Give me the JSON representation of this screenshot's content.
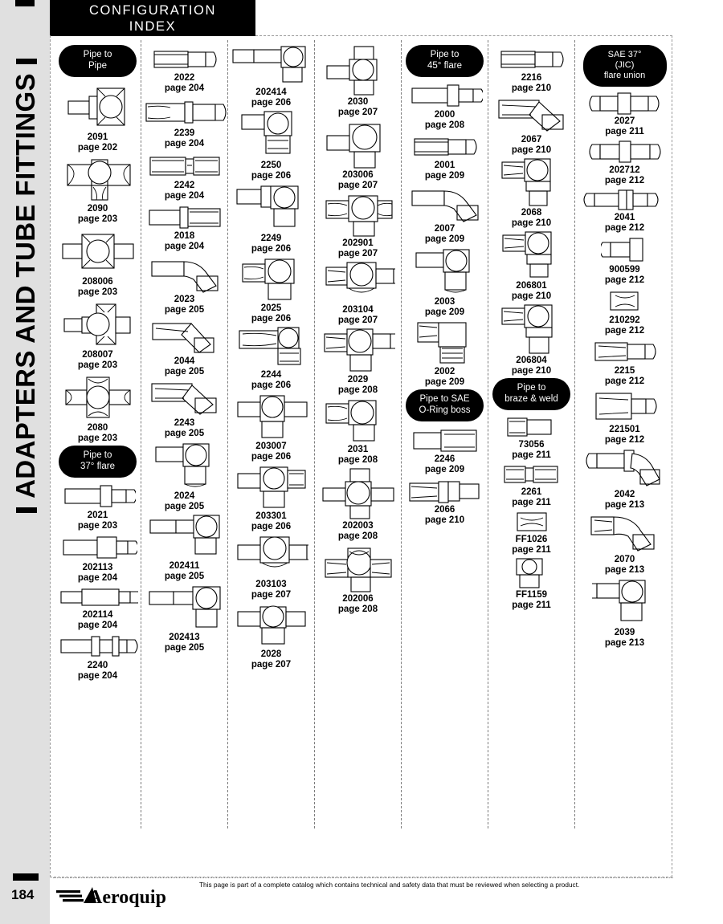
{
  "spine": {
    "title": "ADAPTERS AND TUBE FITTINGS"
  },
  "header": {
    "line1": "CONFIGURATION",
    "line2": "INDEX"
  },
  "footer": {
    "page_number": "184",
    "logo_text": "Aeroquip",
    "disclaimer": "This page is part of a complete catalog which contains technical and safety data that must be reviewed when selecting a product."
  },
  "columns": [
    {
      "name": "column-1",
      "blocks": [
        {
          "heading": "Pipe to\nPipe",
          "heading_lines": [
            "Pipe to",
            "Pipe"
          ],
          "items": [
            {
              "part": "2091",
              "page": "page 202",
              "art": "tee-male-run"
            },
            {
              "part": "2090",
              "page": "page 203",
              "art": "tee-plain"
            },
            {
              "part": "208006",
              "page": "page 203",
              "art": "cross-male-2"
            },
            {
              "part": "208007",
              "page": "page 203",
              "art": "cross-male-1"
            },
            {
              "part": "2080",
              "page": "page 203",
              "art": "cross-plain"
            }
          ]
        },
        {
          "heading_lines": [
            "Pipe to",
            "37° flare"
          ],
          "items": [
            {
              "part": "2021",
              "page": "page 203",
              "art": "straight-hex-mid"
            },
            {
              "part": "202113",
              "page": "page 204",
              "art": "straight-long-hex"
            },
            {
              "part": "202114",
              "page": "page 204",
              "art": "straight-long-plain"
            },
            {
              "part": "2240",
              "page": "page 204",
              "art": "straight-double-hex"
            }
          ]
        }
      ]
    },
    {
      "name": "column-2",
      "blocks": [
        {
          "heading_lines": [],
          "items": [
            {
              "part": "2022",
              "page": "page 204",
              "art": "straight-female-male"
            },
            {
              "part": "2239",
              "page": "page 204",
              "art": "straight-nut-long"
            },
            {
              "part": "2242",
              "page": "page 204",
              "art": "straight-swivel"
            },
            {
              "part": "2018",
              "page": "page 204",
              "art": "straight-male-swivel"
            },
            {
              "part": "2023",
              "page": "page 205",
              "art": "elbow45-male"
            },
            {
              "part": "2044",
              "page": "page 205",
              "art": "elbow45-female"
            },
            {
              "part": "2243",
              "page": "page 205",
              "art": "elbow45-swivel"
            },
            {
              "part": "2024",
              "page": "page 205",
              "art": "elbow90-male"
            },
            {
              "part": "202411",
              "page": "page 205",
              "art": "elbow90-long"
            },
            {
              "part": "202413",
              "page": "page 205",
              "art": "elbow90-long2"
            }
          ]
        }
      ]
    },
    {
      "name": "column-3",
      "blocks": [
        {
          "heading_lines": [],
          "items": [
            {
              "part": "202414",
              "page": "page 206",
              "art": "elbow90-extlong"
            },
            {
              "part": "2250",
              "page": "page 206",
              "art": "elbow90-swivel"
            },
            {
              "part": "2249",
              "page": "page 206",
              "art": "elbow90-male-hex"
            },
            {
              "part": "2025",
              "page": "page 206",
              "art": "elbow90-female-down"
            },
            {
              "part": "2244",
              "page": "page 206",
              "art": "elbow90-plain-down"
            },
            {
              "part": "203007",
              "page": "page 206",
              "art": "tee-3male"
            },
            {
              "part": "203301",
              "page": "page 206",
              "art": "tee-male-branch"
            },
            {
              "part": "203103",
              "page": "page 207",
              "art": "tee-run-male"
            },
            {
              "part": "2028",
              "page": "page 207",
              "art": "tee-male-all"
            }
          ]
        }
      ]
    },
    {
      "name": "column-4",
      "blocks": [
        {
          "heading_lines": [],
          "items": [
            {
              "part": "2030",
              "page": "page 207",
              "art": "tee-vertical-male"
            },
            {
              "part": "203006",
              "page": "page 207",
              "art": "tee-down-male"
            },
            {
              "part": "202901",
              "page": "page 207",
              "art": "tee-branch-down"
            },
            {
              "part": "203104",
              "page": "page 207",
              "art": "tee-right-male"
            },
            {
              "part": "2029",
              "page": "page 208",
              "art": "tee-two-male"
            },
            {
              "part": "2031",
              "page": "page 208",
              "art": "tee-up-male"
            },
            {
              "part": "202003",
              "page": "page 208",
              "art": "cross-4male"
            },
            {
              "part": "202006",
              "page": "page 208",
              "art": "cross-down-male"
            }
          ]
        }
      ]
    },
    {
      "name": "column-5",
      "blocks": [
        {
          "heading_lines": [
            "Pipe to",
            "45° flare"
          ],
          "items": [
            {
              "part": "2000",
              "page": "page 208",
              "art": "straight-hex-mid"
            },
            {
              "part": "2001",
              "page": "page 209",
              "art": "straight-female-male"
            },
            {
              "part": "2007",
              "page": "page 209",
              "art": "elbow45-male"
            },
            {
              "part": "2003",
              "page": "page 209",
              "art": "elbow90-male"
            },
            {
              "part": "2002",
              "page": "page 209",
              "art": "elbow90-female"
            }
          ]
        },
        {
          "heading_lines": [
            "Pipe to SAE",
            "O-Ring boss"
          ],
          "items": [
            {
              "part": "2246",
              "page": "page 209",
              "art": "straight-male-female"
            },
            {
              "part": "2066",
              "page": "page 210",
              "art": "straight-swivel-male"
            }
          ]
        }
      ]
    },
    {
      "name": "column-6",
      "blocks": [
        {
          "heading_lines": [],
          "items": [
            {
              "part": "2216",
              "page": "page 210",
              "art": "straight-female-male"
            },
            {
              "part": "2067",
              "page": "page 210",
              "art": "elbow45-swivel"
            },
            {
              "part": "2068",
              "page": "page 210",
              "art": "elbow90-swivel-down"
            },
            {
              "part": "206801",
              "page": "page 210",
              "art": "elbow90-plain-boss"
            },
            {
              "part": "206804",
              "page": "page 210",
              "art": "elbow90-boss-thread"
            }
          ]
        },
        {
          "heading_lines": [
            "Pipe to",
            "braze & weld"
          ],
          "items": [
            {
              "part": "73056",
              "page": "page 211",
              "art": "plug-male"
            },
            {
              "part": "2261",
              "page": "page 211",
              "art": "coupling-female"
            },
            {
              "part": "FF1026",
              "page": "page 211",
              "art": "sleeve-short"
            },
            {
              "part": "FF1159",
              "page": "page 211",
              "art": "boss-weld"
            }
          ]
        }
      ]
    },
    {
      "name": "column-7",
      "blocks": [
        {
          "heading_lines": [
            "SAE 37°",
            "(JIC)",
            "flare union"
          ],
          "items": [
            {
              "part": "2027",
              "page": "page 211",
              "art": "union-hex"
            },
            {
              "part": "202712",
              "page": "page 212",
              "art": "union-hex-heavy"
            },
            {
              "part": "2041",
              "page": "page 212",
              "art": "union-bulkhead"
            },
            {
              "part": "900599",
              "page": "page 212",
              "art": "male-nut"
            },
            {
              "part": "210292",
              "page": "page 212",
              "art": "nut-only"
            },
            {
              "part": "2215",
              "page": "page 212",
              "art": "swivel-male"
            },
            {
              "part": "221501",
              "page": "page 212",
              "art": "swivel-hex-male"
            },
            {
              "part": "2042",
              "page": "page 213",
              "art": "elbow45-union"
            },
            {
              "part": "2070",
              "page": "page 213",
              "art": "elbow45-swivel-union"
            },
            {
              "part": "2039",
              "page": "page 213",
              "art": "elbow90-union"
            }
          ]
        }
      ]
    }
  ]
}
